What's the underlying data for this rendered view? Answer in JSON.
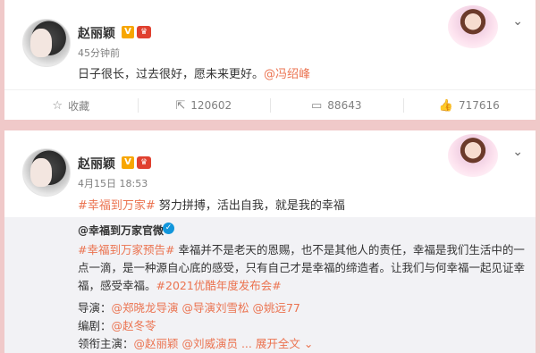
{
  "post1": {
    "author": "赵丽颖",
    "time": "45分钟前",
    "text_main": "日子很长，过去很好，愿未来更好。",
    "mention": "@冯绍峰",
    "actions": [
      {
        "icon": "star-icon",
        "label": "收藏"
      },
      {
        "icon": "repost-icon",
        "label": "120602"
      },
      {
        "icon": "comment-icon",
        "label": "88643"
      },
      {
        "icon": "like-icon",
        "label": "717616"
      }
    ]
  },
  "post2": {
    "author": "赵丽颖",
    "time": "4月15日 18:53",
    "tag": "#幸福到万家#",
    "text_main": " 努力拼搏，活出自我，就是我的幸福",
    "repost": {
      "author": "@幸福到万家官微",
      "tag1": "#幸福到万家预告#",
      "body": " 幸福并不是老天的恩赐，也不是其他人的责任，幸福是我们生活中的一点一滴，是一种源自心底的感受，只有自己才是幸福的缔造者。让我们与何幸福一起见证幸福，感受幸福。",
      "tag2": "#2021优酷年度发布会#",
      "director_label": "导演：",
      "director_names": "@郑晓龙导演 @导演刘雪松 @姚远77",
      "writer_label": "编剧：",
      "writer_names": "@赵冬苓",
      "cast_label": "领衔主演：",
      "cast_names": "@赵丽颖 @刘威演员 ...",
      "expand": "展开全文"
    }
  },
  "colors": {
    "background": "#f0c9c9",
    "accent": "#eb7350",
    "vip": "#f7a600",
    "verified": "#1296db"
  }
}
